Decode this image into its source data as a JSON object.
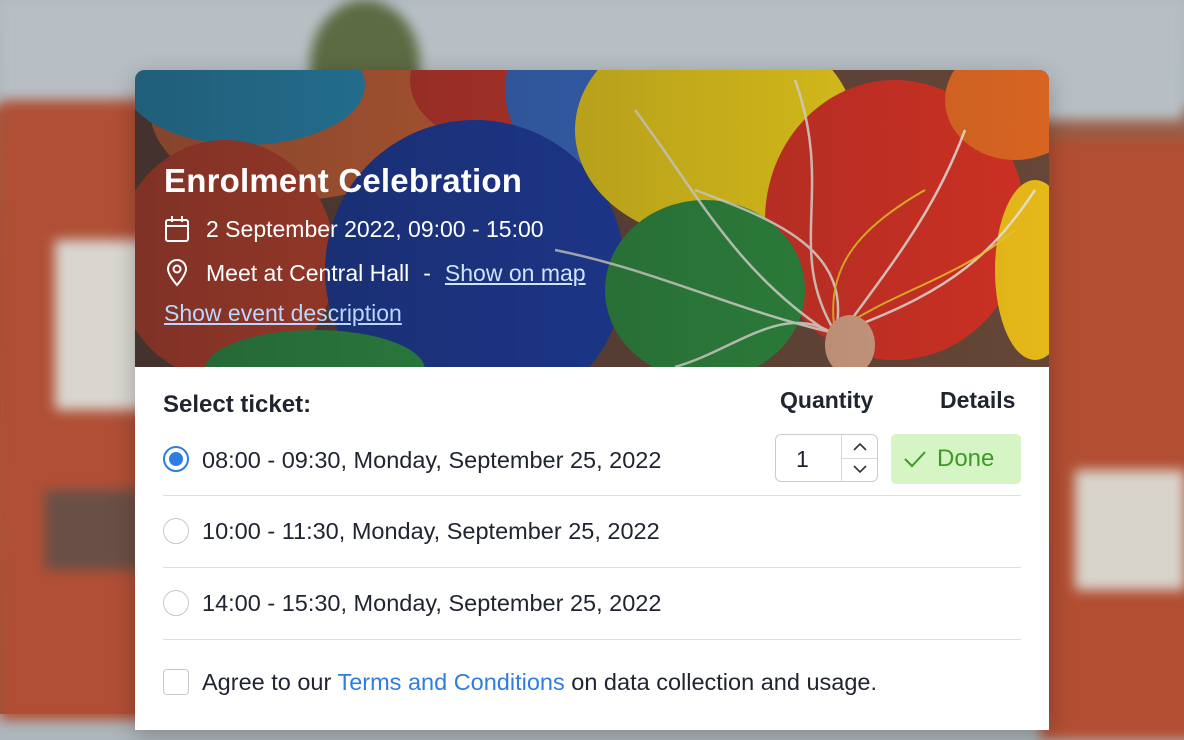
{
  "event": {
    "title": "Enrolment Celebration",
    "datetime": "2 September 2022, 09:00 - 15:00",
    "location": "Meet at Central Hall",
    "location_separator": "-",
    "map_link": "Show on map",
    "description_link": "Show event description"
  },
  "tickets": {
    "select_label": "Select ticket:",
    "quantity_header": "Quantity",
    "details_header": "Details",
    "options": [
      {
        "label": "08:00 - 09:30, Monday, September 25, 2022",
        "selected": true,
        "quantity": "1",
        "details_label": "Done"
      },
      {
        "label": "10:00 - 11:30, Monday, September 25, 2022",
        "selected": false
      },
      {
        "label": "14:00 - 15:30, Monday, September 25, 2022",
        "selected": false
      }
    ]
  },
  "agreement": {
    "prefix": "Agree to our",
    "terms_link": "Terms and Conditions",
    "suffix": "on data collection and usage.",
    "checked": false
  },
  "colors": {
    "accent": "#2f7de1",
    "done_bg": "#d6f5c4",
    "done_text": "#3e9a26"
  }
}
